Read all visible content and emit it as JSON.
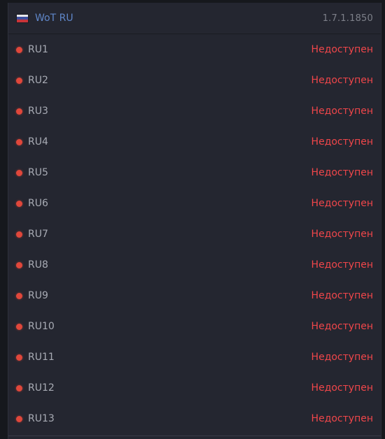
{
  "header": {
    "flag_icon": "russia-flag-icon",
    "title": "WoT RU",
    "version": "1.7.1.1850"
  },
  "colors": {
    "title": "#5f86c8",
    "status_offline": "#f0464a",
    "dot_offline": "#e0473b"
  },
  "servers": [
    {
      "name": "RU1",
      "status": "Недоступен"
    },
    {
      "name": "RU2",
      "status": "Недоступен"
    },
    {
      "name": "RU3",
      "status": "Недоступен"
    },
    {
      "name": "RU4",
      "status": "Недоступен"
    },
    {
      "name": "RU5",
      "status": "Недоступен"
    },
    {
      "name": "RU6",
      "status": "Недоступен"
    },
    {
      "name": "RU7",
      "status": "Недоступен"
    },
    {
      "name": "RU8",
      "status": "Недоступен"
    },
    {
      "name": "RU9",
      "status": "Недоступен"
    },
    {
      "name": "RU10",
      "status": "Недоступен"
    },
    {
      "name": "RU11",
      "status": "Недоступен"
    },
    {
      "name": "RU12",
      "status": "Недоступен"
    },
    {
      "name": "RU13",
      "status": "Недоступен"
    }
  ]
}
